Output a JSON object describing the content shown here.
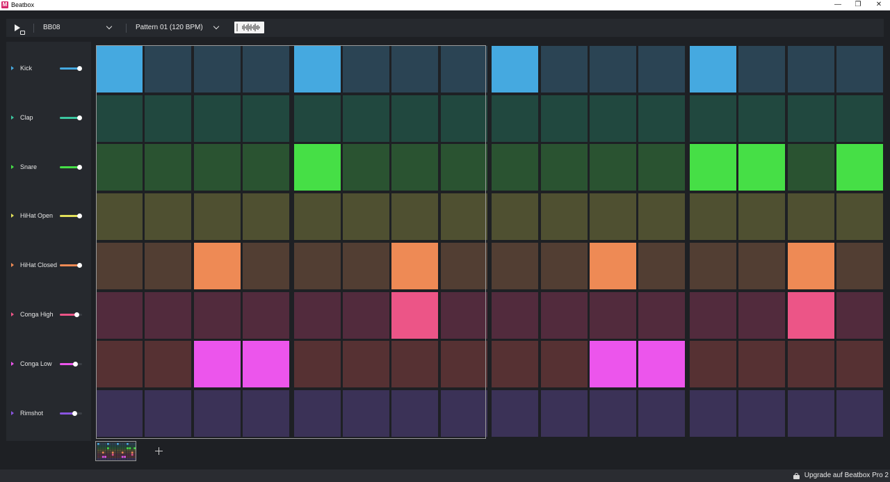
{
  "window": {
    "title": "Beatbox",
    "icon_letter": "M",
    "controls": {
      "minimize": "—",
      "maximize": "❐",
      "close": "✕"
    }
  },
  "toolbar": {
    "kit_value": "BB08",
    "pattern_value": "Pattern 01 (120 BPM)",
    "icons": [
      "play-icon",
      "loop-icon",
      "chevron-down-icon",
      "waveform-icon"
    ]
  },
  "colors": {
    "background": "#1e2024",
    "panel": "#26292e",
    "frame": "#9a9a9a"
  },
  "tracks": [
    {
      "name": "Kick",
      "color": "#45a9e0",
      "cell_off": "#2b4454",
      "volume": 0.88,
      "steps": [
        1,
        0,
        0,
        0,
        1,
        0,
        0,
        0,
        1,
        0,
        0,
        0,
        1,
        0,
        0,
        0
      ]
    },
    {
      "name": "Clap",
      "color": "#3cc6a0",
      "cell_off": "#21483f",
      "volume": 0.88,
      "steps": [
        0,
        0,
        0,
        0,
        0,
        0,
        0,
        0,
        0,
        0,
        0,
        0,
        0,
        0,
        0,
        0
      ]
    },
    {
      "name": "Snare",
      "color": "#46df46",
      "cell_off": "#2a5331",
      "volume": 0.88,
      "steps": [
        0,
        0,
        0,
        0,
        1,
        0,
        0,
        0,
        0,
        0,
        0,
        0,
        1,
        1,
        0,
        1
      ]
    },
    {
      "name": "HiHat Open",
      "color": "#e2e05a",
      "cell_off": "#4f5031",
      "volume": 0.88,
      "steps": [
        0,
        0,
        0,
        0,
        0,
        0,
        0,
        0,
        0,
        0,
        0,
        0,
        0,
        0,
        0,
        0
      ]
    },
    {
      "name": "HiHat Closed",
      "color": "#ee8a55",
      "cell_off": "#523e33",
      "volume": 0.88,
      "steps": [
        0,
        0,
        1,
        0,
        0,
        0,
        1,
        0,
        0,
        0,
        1,
        0,
        0,
        0,
        1,
        0
      ]
    },
    {
      "name": "Conga High",
      "color": "#ec5587",
      "cell_off": "#522b3d",
      "volume": 0.75,
      "steps": [
        0,
        0,
        0,
        0,
        0,
        0,
        1,
        0,
        0,
        0,
        0,
        0,
        0,
        0,
        1,
        0
      ]
    },
    {
      "name": "Conga Low",
      "color": "#ec55ec",
      "cell_off": "#563133",
      "volume": 0.69,
      "steps": [
        0,
        0,
        1,
        1,
        0,
        0,
        0,
        0,
        0,
        0,
        1,
        1,
        0,
        0,
        0,
        0
      ]
    },
    {
      "name": "Rimshot",
      "color": "#8a55e0",
      "cell_off": "#3b3257",
      "volume": 0.66,
      "steps": [
        0,
        0,
        0,
        0,
        0,
        0,
        0,
        0,
        0,
        0,
        0,
        0,
        0,
        0,
        0,
        0
      ]
    }
  ],
  "statusbar": {
    "upgrade_label": "Upgrade auf Beatbox Pro 2"
  }
}
